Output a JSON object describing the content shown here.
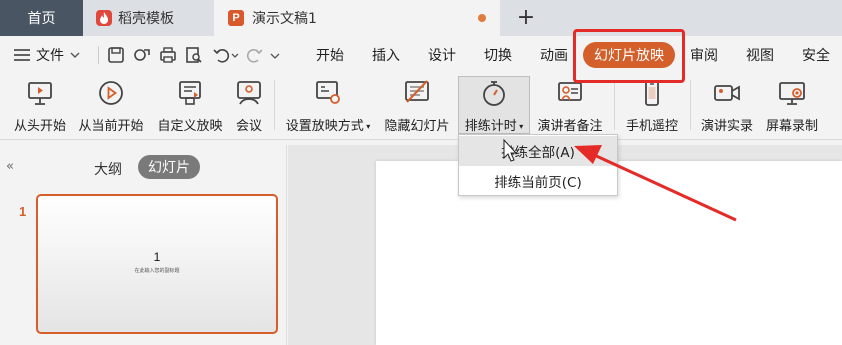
{
  "tabs": {
    "home": "首页",
    "templates": "稻壳模板",
    "document": "演示文稿1",
    "new_tab": "+"
  },
  "menu": {
    "file": "文件",
    "items": [
      "开始",
      "插入",
      "设计",
      "切换",
      "动画",
      "幻灯片放映",
      "审阅",
      "视图",
      "安全"
    ],
    "active": "幻灯片放映"
  },
  "ribbon": {
    "from_start": "从头开始",
    "from_current": "从当前开始",
    "custom_show": "自定义放映",
    "meeting": "会议",
    "setup_show": "设置放映方式",
    "hide_slide": "隐藏幻灯片",
    "rehearse": "排练计时",
    "presenter_notes": "演讲者备注",
    "phone_remote": "手机遥控",
    "record": "演讲实录",
    "screen_record": "屏幕录制"
  },
  "dropdown": {
    "rehearse_all": "排练全部(A)",
    "rehearse_current": "排练当前页(C)"
  },
  "panel": {
    "collapse": "«",
    "outline_tab": "大纲",
    "slides_tab": "幻灯片",
    "slide_number": "1",
    "thumb_title": "1",
    "thumb_subtitle": "在此输入您的副标题"
  },
  "colors": {
    "accent": "#d45f2a",
    "highlight_box": "#e52b27",
    "home_tab": "#4a5564"
  }
}
